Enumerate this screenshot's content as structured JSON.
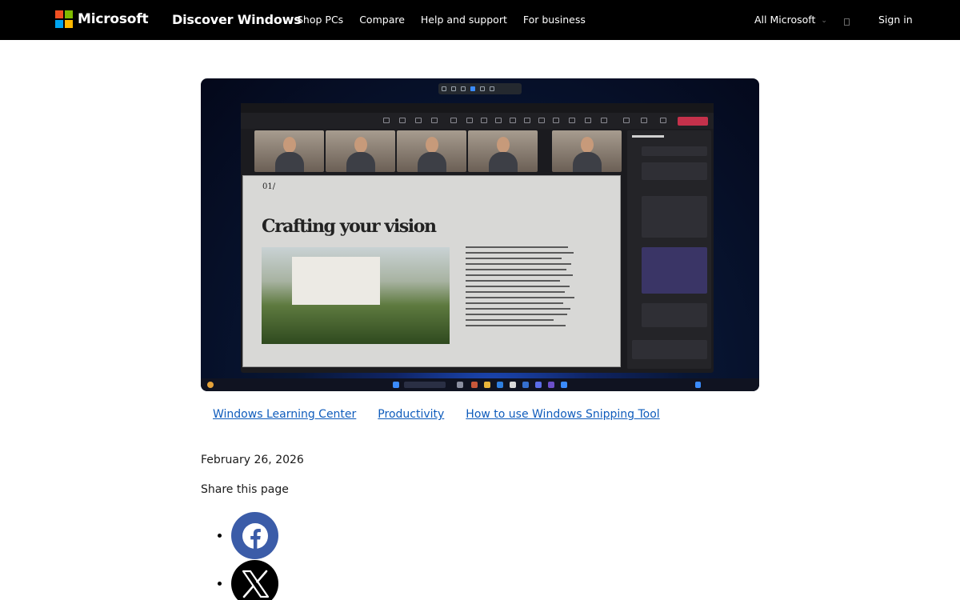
{
  "header": {
    "brand": "Microsoft",
    "site_title": "Discover Windows",
    "nav_links": [
      "Shop PCs",
      "Compare",
      "Help and support",
      "For business"
    ],
    "all_microsoft": "All Microsoft",
    "sign_in": "Sign in",
    "colors": {
      "background": "#000000",
      "text": "#ffffff"
    }
  },
  "hero": {
    "slide_number": "01/",
    "slide_heading": "Crafting your vision"
  },
  "tags": [
    "Windows Learning Center",
    "Productivity",
    "How to use Windows Snipping Tool"
  ],
  "article": {
    "date": "February 26, 2026",
    "share_label": "Share this page"
  },
  "share": [
    {
      "icon": "facebook-icon",
      "color": "#3b5ca8"
    },
    {
      "icon": "x-icon",
      "color": "#000000"
    }
  ],
  "colors": {
    "link": "#0f5cbc",
    "text": "#1a1a1a"
  }
}
